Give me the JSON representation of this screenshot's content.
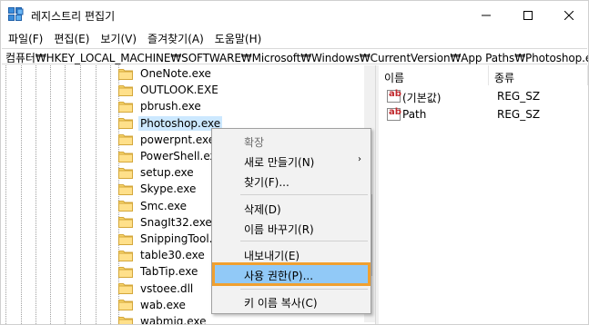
{
  "window": {
    "title": "레지스트리 편집기",
    "icons": {
      "app": "registry-editor-icon",
      "minimize": "minimize-icon",
      "maximize": "maximize-icon",
      "close": "close-icon"
    }
  },
  "menu": {
    "items": [
      "파일(F)",
      "편집(E)",
      "보기(V)",
      "즐겨찾기(A)",
      "도움말(H)"
    ]
  },
  "address": {
    "path": "컴퓨터₩HKEY_LOCAL_MACHINE₩SOFTWARE₩Microsoft₩Windows₩CurrentVersion₩App Paths₩Photoshop.exe"
  },
  "tree": {
    "items": [
      "OneNote.exe",
      "OUTLOOK.EXE",
      "pbrush.exe",
      "Photoshop.exe",
      "powerpnt.exe",
      "PowerShell.exe",
      "setup.exe",
      "Skype.exe",
      "Smc.exe",
      "SnagIt32.exe",
      "SnippingTool.exe",
      "table30.exe",
      "TabTip.exe",
      "vstoee.dll",
      "wab.exe",
      "wabmig.exe"
    ],
    "selected_index": 3,
    "folder_color": "#f6d46b"
  },
  "values": {
    "columns": {
      "name": "이름",
      "type": "종류"
    },
    "rows": [
      {
        "name": "(기본값)",
        "type": "REG_SZ",
        "icon": "string-value-icon"
      },
      {
        "name": "Path",
        "type": "REG_SZ",
        "icon": "string-value-icon"
      }
    ],
    "icon_text": "ab"
  },
  "context_menu": {
    "expand": "확장",
    "new": "새로 만들기(N)",
    "find": "찾기(F)...",
    "delete": "삭제(D)",
    "rename": "이름 바꾸기(R)",
    "export": "내보내기(E)",
    "permissions": "사용 권한(P)...",
    "copy_key": "키 이름 복사(C)",
    "submenu_arrow": "›"
  },
  "colors": {
    "selection": "#cce8ff",
    "menu_highlight": "#91c9f7",
    "highlight_outline": "#f0a030"
  }
}
